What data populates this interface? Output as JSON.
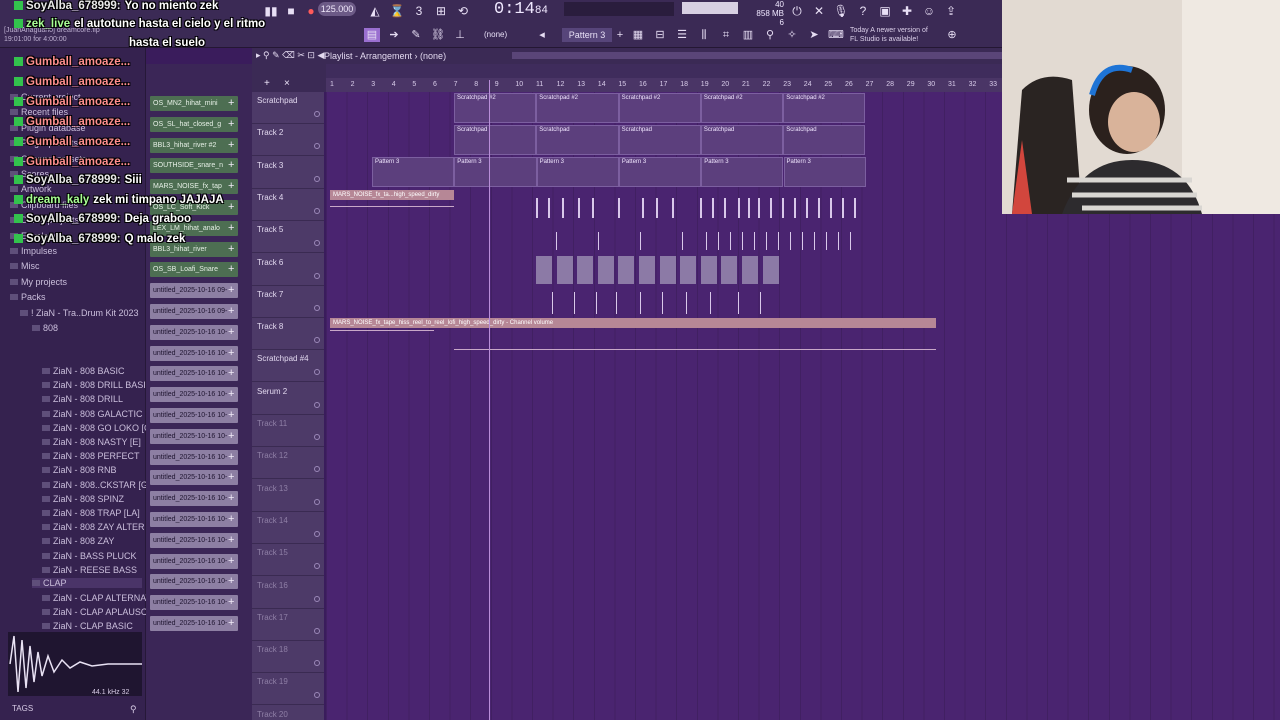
{
  "toolbar": {
    "bpm": "125.000",
    "time": "0:14",
    "time_frames": "84",
    "cpu_mem": "858 MB",
    "cpu_line2": "6",
    "cpu_top": "40",
    "pattern": "Pattern 3",
    "none_label": "(none)",
    "news_line1": "Today  A newer version of",
    "news_line2": "FL Studio is available!",
    "file_title": "[JuanAnaguano] dreamcore.flp",
    "file_time": "19:01:00 for 4:00:00"
  },
  "playlist": {
    "title": "Playlist - Arrangement",
    "sub": "(none)",
    "ruler_ticks": [
      "1",
      "2",
      "3",
      "4",
      "5",
      "6",
      "7",
      "8",
      "9",
      "10",
      "11",
      "12",
      "13",
      "14",
      "15",
      "16",
      "17",
      "18",
      "19",
      "20",
      "21",
      "22",
      "23",
      "24",
      "25",
      "26",
      "27",
      "28",
      "29",
      "30",
      "31",
      "32",
      "33"
    ]
  },
  "tracks": [
    {
      "name": "Scratchpad"
    },
    {
      "name": "Track 2"
    },
    {
      "name": "Track 3"
    },
    {
      "name": "Track 4"
    },
    {
      "name": "Track 5"
    },
    {
      "name": "Track 6"
    },
    {
      "name": "Track 7"
    },
    {
      "name": "Track 8"
    },
    {
      "name": "Scratchpad #4"
    },
    {
      "name": "Serum 2"
    },
    {
      "name": "Track 11"
    },
    {
      "name": "Track 12"
    },
    {
      "name": "Track 13"
    },
    {
      "name": "Track 14"
    },
    {
      "name": "Track 15"
    },
    {
      "name": "Track 16"
    },
    {
      "name": "Track 17"
    },
    {
      "name": "Track 18"
    },
    {
      "name": "Track 19"
    },
    {
      "name": "Track 20"
    }
  ],
  "clips": {
    "scratchpad2": "Scratchpad #2",
    "scratchpad": "Scratchpad",
    "pattern3": "Pattern 3",
    "mars_short": "MARS_NOISE_fx_ta...high_speed_dirty",
    "mars_long": "MARS_NOISE_fx_tape_hiss_reel_to_reel_lofi_high_speed_dirty - Channel volume"
  },
  "channels": [
    "OS_MN2_hihat_mini",
    "OS_SL_hat_closed_g",
    "BBL3_hihat_river #2",
    "SOUTHSIDE_snare_n",
    "MARS_NOISE_fx_tap",
    "OS_LC_Soft_Kick",
    "LEX_LM_hihat_analo",
    "BBL3_hihat_river",
    "OS_SB_Loafi_Snare",
    "untitled_2025-10-16 09-",
    "untitled_2025-10-16 09-",
    "untitled_2025-10-16 10-",
    "untitled_2025-10-16 10-",
    "untitled_2025-10-16 10-",
    "untitled_2025-10-16 10-",
    "untitled_2025-10-16 10-",
    "untitled_2025-10-16 10-",
    "untitled_2025-10-16 10-",
    "untitled_2025-10-16 10-",
    "untitled_2025-10-16 10-",
    "untitled_2025-10-16 10-",
    "untitled_2025-10-16 10-",
    "untitled_2025-10-16 10-",
    "untitled_2025-10-16 10-",
    "untitled_2025-10-16 10-",
    "untitled_2025-10-16 10-"
  ],
  "browser": {
    "items": [
      "Current project",
      "Recent files",
      "Plugin database",
      "Plugin presets",
      "Channel presets",
      "Scores",
      "Artwork",
      "Clipboard files",
      "Demo projects",
      "Envelopes",
      "Impulses",
      "Misc",
      "My projects",
      "Packs",
      "! ZiaN - Tra..Drum Kit 2023",
      "808"
    ],
    "samples": [
      "ZiaN - 808 BASIC",
      "ZiaN - 808 DRILL BASIC",
      "ZiaN - 808 DRILL",
      "ZiaN - 808 GALACTIC",
      "ZiaN - 808 GO LOKO [G#]",
      "ZiaN - 808 NASTY [E]",
      "ZiaN - 808 PERFECT",
      "ZiaN - 808 RNB",
      "ZiaN - 808..CKSTAR [G#]",
      "ZiaN - 808 SPINZ",
      "ZiaN - 808 TRAP [LA]",
      "ZiaN - 808 ZAY ALTER",
      "ZiaN - 808 ZAY",
      "ZiaN - BASS PLUCK",
      "ZiaN - REESE BASS"
    ],
    "clap_folder": "CLAP",
    "clap_samples": [
      "ZiaN - CLAP ALTERNATIVE",
      "ZiaN - CLAP APLAUSO",
      "ZiaN - CLAP BASIC"
    ],
    "wave_info": "44.1 kHz 32",
    "tags": "TAGS"
  },
  "chat": [
    {
      "user": "SoyAlba_678999:",
      "msg": "Yo no miento zek",
      "color": "white"
    },
    {
      "user": "zek_live",
      "msg": "el autotune hasta el cielo y el ritmo",
      "color": "green"
    },
    {
      "user": "",
      "msg": "hasta el suelo",
      "color": "green"
    },
    {
      "user": "Gumball_amoaze...",
      "msg": "",
      "color": "red"
    },
    {
      "user": "Gumball_amoaze...",
      "msg": "",
      "color": "red"
    },
    {
      "user": "Gumball_amoaze...",
      "msg": "",
      "color": "red"
    },
    {
      "user": "Gumball_amoaze...",
      "msg": "",
      "color": "red"
    },
    {
      "user": "Gumball_amoaze...",
      "msg": "",
      "color": "red"
    },
    {
      "user": "Gumball_amoaze...",
      "msg": "",
      "color": "red"
    },
    {
      "user": "SoyAlba_678999:",
      "msg": "Siii",
      "color": "white"
    },
    {
      "user": "dream_kaly",
      "msg": "zek mi timpano JAJAJA",
      "color": "green"
    },
    {
      "user": "SoyAlba_678999:",
      "msg": "Deja graboo",
      "color": "white"
    },
    {
      "user": "SoyAlba_678999:",
      "msg": "Q malo zek",
      "color": "white"
    }
  ],
  "colors": {
    "grid_bg": "#4a2470",
    "clip": "#5c3f7d",
    "audio_clip": "#b68796",
    "accent": "#c86bff"
  }
}
